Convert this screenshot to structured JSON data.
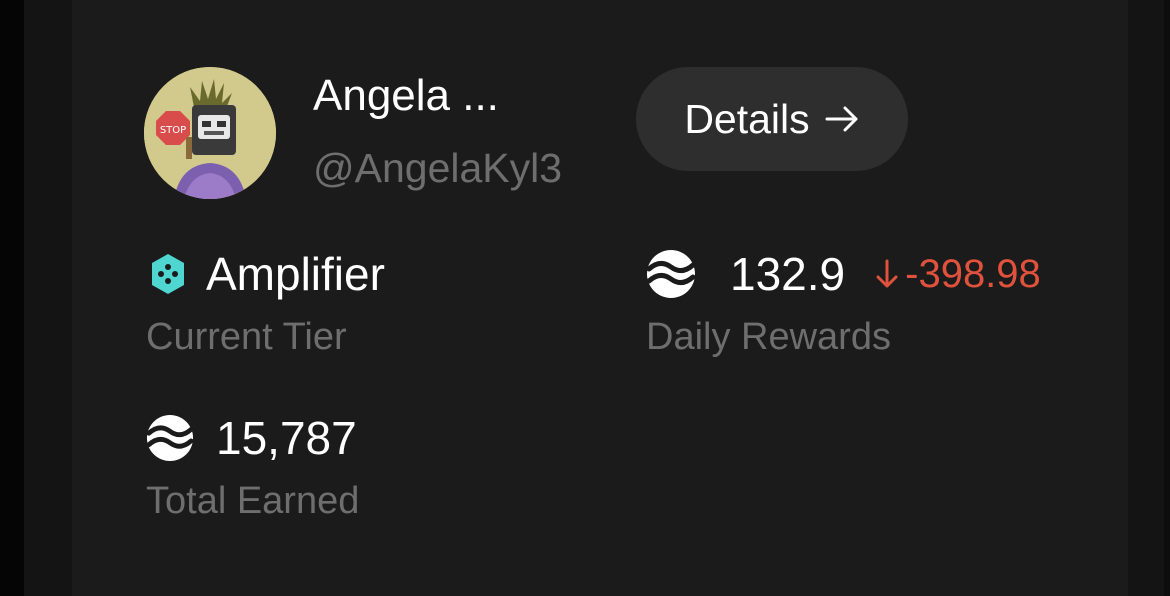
{
  "profile": {
    "name": "Angela ...",
    "handle": "@AngelaKyl3",
    "avatar_icon": "avatar-image"
  },
  "details_button": {
    "label": "Details",
    "icon": "arrow-right-icon"
  },
  "stats": {
    "tier": {
      "value": "Amplifier",
      "label": "Current Tier",
      "icon": "tier-diamond-icon",
      "icon_color": "#4fd6d0"
    },
    "daily_rewards": {
      "value": "132.9",
      "label": "Daily Rewards",
      "icon": "token-wave-icon",
      "delta": "-398.98",
      "delta_icon": "arrow-down-icon",
      "delta_color": "#e0523d"
    },
    "total_earned": {
      "value": "15,787",
      "label": "Total Earned",
      "icon": "token-wave-icon"
    }
  },
  "colors": {
    "background": "#1b1b1b",
    "button_background": "#2e2e2e",
    "primary_text": "#ffffff",
    "secondary_text": "#6e6e6e"
  }
}
